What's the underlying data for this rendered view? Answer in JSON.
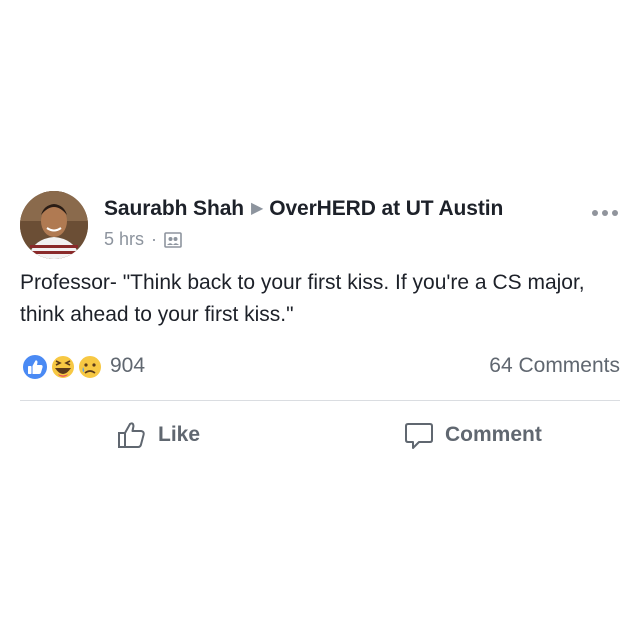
{
  "post": {
    "author": "Saurabh Shah",
    "group": "OverHERD at UT Austin",
    "time": "5 hrs",
    "separator": "·",
    "audience_icon": "group-icon",
    "text": "Professor- \"Think back to your first kiss. If you're a CS major, think ahead to your first kiss.\""
  },
  "reactions": {
    "icons": [
      "like-icon",
      "haha-icon",
      "sad-icon"
    ],
    "count": "904",
    "comments": "64 Comments"
  },
  "actions": {
    "like_label": "Like",
    "comment_label": "Comment"
  },
  "colors": {
    "like_blue": "#4a8af4",
    "emoji_yellow": "#f7c843",
    "text_gray": "#606770"
  }
}
